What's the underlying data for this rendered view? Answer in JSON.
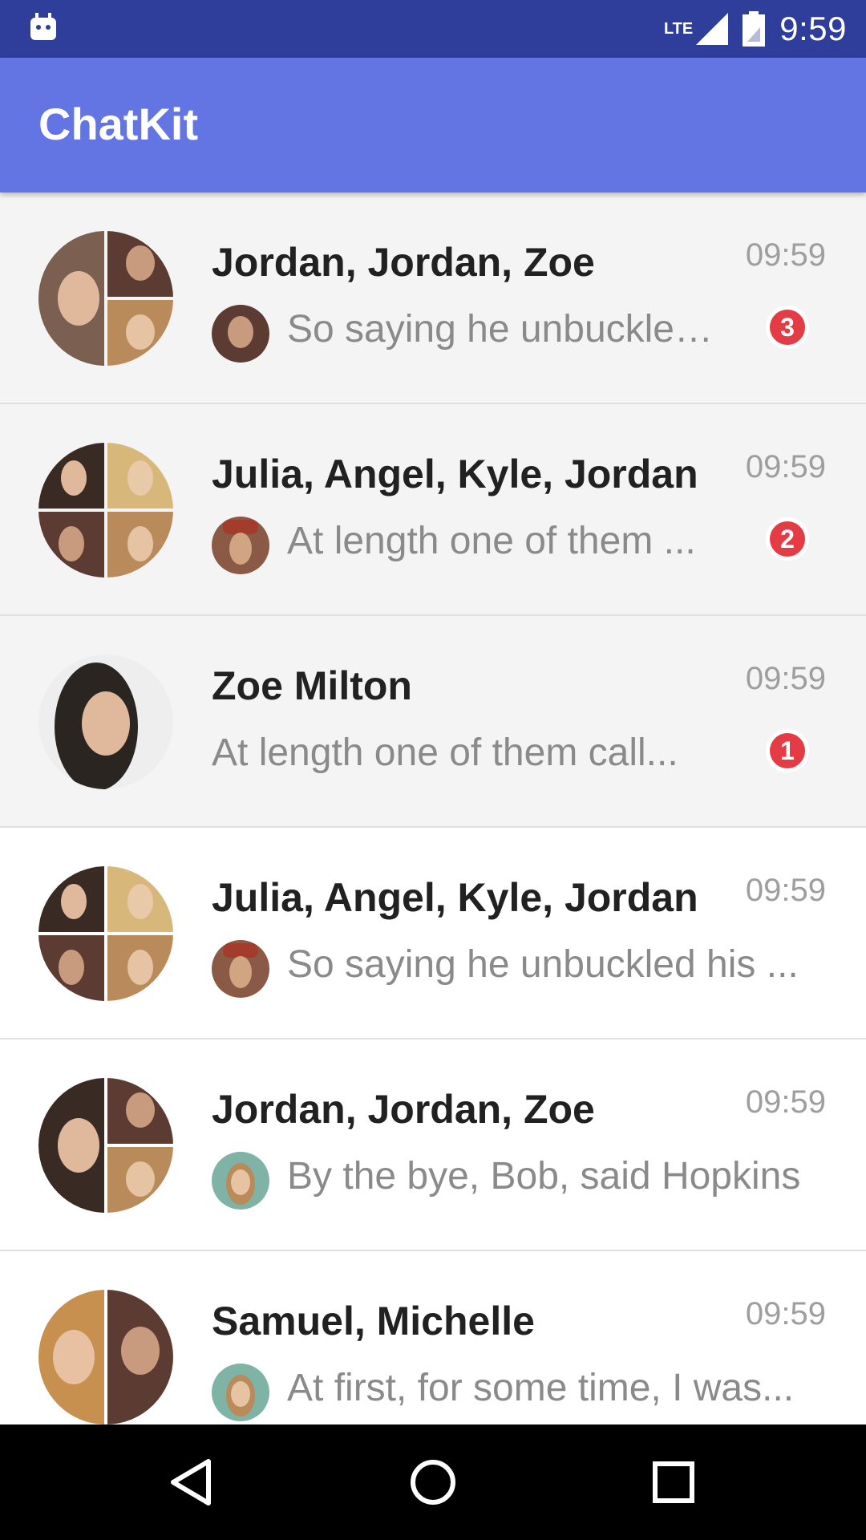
{
  "status_bar": {
    "network": "LTE",
    "time": "9:59",
    "icons": [
      "android-icon",
      "signal-icon",
      "battery-icon"
    ]
  },
  "app_bar": {
    "title": "ChatKit"
  },
  "colors": {
    "status_bar": "#2f3d9b",
    "app_bar": "#6374e3",
    "badge": "#e53b44",
    "unread_bg": "#f4f4f4"
  },
  "dialogs": [
    {
      "name": "Jordan, Jordan, Zoe",
      "time": "09:59",
      "message": "So saying he unbuckled...",
      "unread": "3"
    },
    {
      "name": "Julia, Angel, Kyle, Jordan",
      "time": "09:59",
      "message": "At length one of them ...",
      "unread": "2"
    },
    {
      "name": "Zoe Milton",
      "time": "09:59",
      "message": "At length one of them call...",
      "unread": "1"
    },
    {
      "name": "Julia, Angel, Kyle, Jordan",
      "time": "09:59",
      "message": "So saying he unbuckled his ..."
    },
    {
      "name": "Jordan, Jordan, Zoe",
      "time": "09:59",
      "message": "By the bye, Bob, said Hopkins"
    },
    {
      "name": "Samuel, Michelle",
      "time": "09:59",
      "message": "At first, for some time, I was..."
    }
  ],
  "nav": [
    "back-icon",
    "home-icon",
    "recents-icon"
  ]
}
